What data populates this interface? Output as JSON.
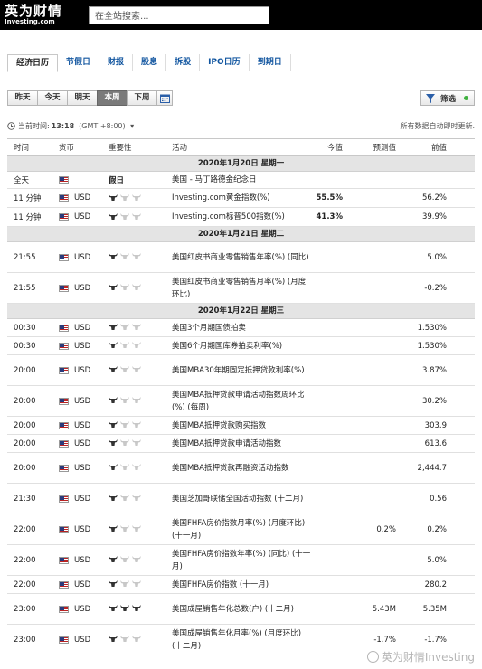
{
  "header": {
    "logo_cn": "英为财情",
    "logo_en": "Investing.com",
    "search_placeholder": "在全站搜索..."
  },
  "tabs": [
    "经济日历",
    "节假日",
    "财报",
    "股息",
    "拆股",
    "IPO日历",
    "到期日"
  ],
  "days": [
    "昨天",
    "今天",
    "明天",
    "本周",
    "下周"
  ],
  "filter_label": "筛选",
  "timebar": {
    "label": "当前时间:",
    "time": "13:18",
    "tz": "(GMT +8:00)",
    "right": "所有数据自动即时更新."
  },
  "columns": {
    "time": "时间",
    "currency": "货币",
    "importance": "重要性",
    "event": "活动",
    "actual": "今值",
    "forecast": "预测值",
    "previous": "前值"
  },
  "sections": [
    {
      "date": "2020年1月20日 星期一",
      "rows": [
        {
          "time": "全天",
          "currency": "",
          "importance": "假日",
          "event": "美国 - 马丁路德金纪念日",
          "actual": "",
          "forecast": "",
          "previous": "",
          "holiday": true,
          "bulls": 0,
          "h": 19
        },
        {
          "time": "11 分钟",
          "currency": "USD",
          "event": "Investing.com黄金指数(%)",
          "actual": "55.5%",
          "forecast": "",
          "previous": "56.2%",
          "bulls": 1,
          "h": 21
        },
        {
          "time": "11 分钟",
          "currency": "USD",
          "event": "Investing.com标普500指数(%)",
          "actual": "41.3%",
          "forecast": "",
          "previous": "39.9%",
          "bulls": 1,
          "h": 21
        }
      ]
    },
    {
      "date": "2020年1月21日 星期二",
      "rows": [
        {
          "time": "21:55",
          "currency": "USD",
          "event": "美国红皮书商业零售销售年率(%) (同比)",
          "actual": "",
          "forecast": "",
          "previous": "5.0%",
          "bulls": 1,
          "h": 34
        },
        {
          "time": "21:55",
          "currency": "USD",
          "event": "美国红皮书商业零售销售月率(%) (月度环比)",
          "actual": "",
          "forecast": "",
          "previous": "-0.2%",
          "bulls": 1,
          "h": 34
        }
      ]
    },
    {
      "date": "2020年1月22日 星期三",
      "rows": [
        {
          "time": "00:30",
          "currency": "USD",
          "event": "美国3个月期国债拍卖",
          "actual": "",
          "forecast": "",
          "previous": "1.530%",
          "bulls": 1,
          "h": 20
        },
        {
          "time": "00:30",
          "currency": "USD",
          "event": "美国6个月期国库券拍卖利率(%)",
          "actual": "",
          "forecast": "",
          "previous": "1.530%",
          "bulls": 1,
          "h": 20
        },
        {
          "time": "20:00",
          "currency": "USD",
          "event": "美国MBA30年期固定抵押贷款利率(%)",
          "actual": "",
          "forecast": "",
          "previous": "3.87%",
          "bulls": 1,
          "h": 34
        },
        {
          "time": "20:00",
          "currency": "USD",
          "event": "美国MBA抵押贷款申请活动指数周环比(%) (每周)",
          "actual": "",
          "forecast": "",
          "previous": "30.2%",
          "bulls": 1,
          "h": 34
        },
        {
          "time": "20:00",
          "currency": "USD",
          "event": "美国MBA抵押贷款购买指数",
          "actual": "",
          "forecast": "",
          "previous": "303.9",
          "bulls": 1,
          "h": 20
        },
        {
          "time": "20:00",
          "currency": "USD",
          "event": "美国MBA抵押贷款申请活动指数",
          "actual": "",
          "forecast": "",
          "previous": "613.6",
          "bulls": 1,
          "h": 20
        },
        {
          "time": "20:00",
          "currency": "USD",
          "event": "美国MBA抵押贷款再融资活动指数",
          "actual": "",
          "forecast": "",
          "previous": "2,444.7",
          "bulls": 1,
          "h": 34
        },
        {
          "time": "21:30",
          "currency": "USD",
          "event": "美国芝加哥联储全国活动指数 (十二月)",
          "actual": "",
          "forecast": "",
          "previous": "0.56",
          "bulls": 1,
          "h": 34
        },
        {
          "time": "22:00",
          "currency": "USD",
          "event": "美国FHFA房价指数月率(%) (月度环比) (十一月)",
          "actual": "",
          "forecast": "0.2%",
          "previous": "0.2%",
          "bulls": 1,
          "h": 34
        },
        {
          "time": "22:00",
          "currency": "USD",
          "event": "美国FHFA房价指数年率(%) (同比) (十一月)",
          "actual": "",
          "forecast": "",
          "previous": "5.0%",
          "bulls": 1,
          "h": 34
        },
        {
          "time": "22:00",
          "currency": "USD",
          "event": "美国FHFA房价指数 (十一月)",
          "actual": "",
          "forecast": "",
          "previous": "280.2",
          "bulls": 1,
          "h": 20
        },
        {
          "time": "23:00",
          "currency": "USD",
          "event": "美国成屋销售年化总数(户) (十二月)",
          "actual": "",
          "forecast": "5.43M",
          "previous": "5.35M",
          "bulls": 3,
          "h": 34
        },
        {
          "time": "23:00",
          "currency": "USD",
          "event": "美国成屋销售年化月率(%) (月度环比) (十二月)",
          "actual": "",
          "forecast": "-1.7%",
          "previous": "-1.7%",
          "bulls": 1,
          "h": 34
        }
      ]
    }
  ],
  "watermark": "英为财情Investing",
  "colors": {
    "bull_active": "#333333",
    "bull_inactive": "#c8c8c8",
    "link": "#1256a0"
  }
}
